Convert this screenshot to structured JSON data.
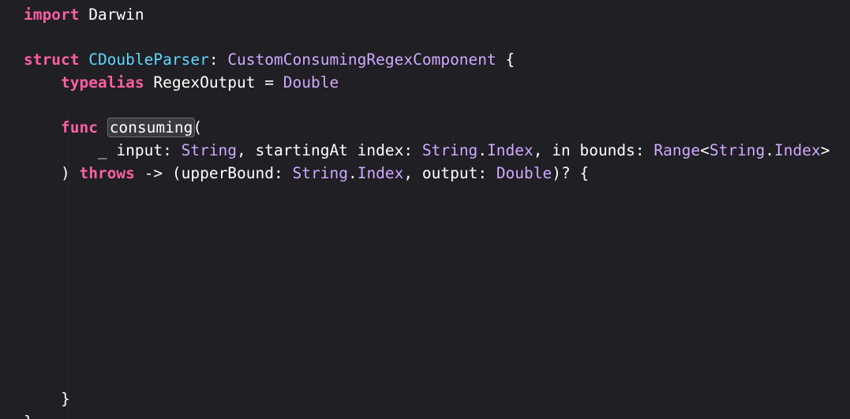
{
  "editor": {
    "lines": [
      [
        {
          "text": "import",
          "kind": "kw"
        },
        {
          "text": " Darwin",
          "kind": "plain"
        }
      ],
      [],
      [
        {
          "text": "struct",
          "kind": "kw"
        },
        {
          "text": " ",
          "kind": "plain"
        },
        {
          "text": "CDoubleParser",
          "kind": "decl"
        },
        {
          "text": ": ",
          "kind": "plain"
        },
        {
          "text": "CustomConsumingRegexComponent",
          "kind": "typ"
        },
        {
          "text": " {",
          "kind": "plain"
        }
      ],
      [
        {
          "text": "    ",
          "kind": "plain"
        },
        {
          "text": "typealias",
          "kind": "kw"
        },
        {
          "text": " RegexOutput = ",
          "kind": "plain"
        },
        {
          "text": "Double",
          "kind": "typ"
        }
      ],
      [],
      [
        {
          "text": "    ",
          "kind": "plain"
        },
        {
          "text": "func",
          "kind": "kw"
        },
        {
          "text": " ",
          "kind": "plain"
        },
        {
          "text": "consuming",
          "kind": "hl"
        },
        {
          "text": "(",
          "kind": "plain"
        }
      ],
      [
        {
          "text": "        _ input: ",
          "kind": "plain"
        },
        {
          "text": "String",
          "kind": "typ"
        },
        {
          "text": ", startingAt index: ",
          "kind": "plain"
        },
        {
          "text": "String",
          "kind": "typ"
        },
        {
          "text": ".",
          "kind": "plain"
        },
        {
          "text": "Index",
          "kind": "typ"
        },
        {
          "text": ", in bounds: ",
          "kind": "plain"
        },
        {
          "text": "Range",
          "kind": "typ"
        },
        {
          "text": "<",
          "kind": "plain"
        },
        {
          "text": "String",
          "kind": "typ"
        },
        {
          "text": ".",
          "kind": "plain"
        },
        {
          "text": "Index",
          "kind": "typ"
        },
        {
          "text": ">",
          "kind": "plain"
        }
      ],
      [
        {
          "text": "    ) ",
          "kind": "plain"
        },
        {
          "text": "throws",
          "kind": "kw"
        },
        {
          "text": " -> (upperBound: ",
          "kind": "plain"
        },
        {
          "text": "String",
          "kind": "typ"
        },
        {
          "text": ".",
          "kind": "plain"
        },
        {
          "text": "Index",
          "kind": "typ"
        },
        {
          "text": ", output: ",
          "kind": "plain"
        },
        {
          "text": "Double",
          "kind": "typ"
        },
        {
          "text": ")? {",
          "kind": "plain"
        }
      ],
      [],
      [],
      [],
      [],
      [],
      [],
      [],
      [],
      [],
      [
        {
          "text": "    }",
          "kind": "plain"
        }
      ],
      [
        {
          "text": "}",
          "kind": "plain"
        }
      ]
    ]
  }
}
